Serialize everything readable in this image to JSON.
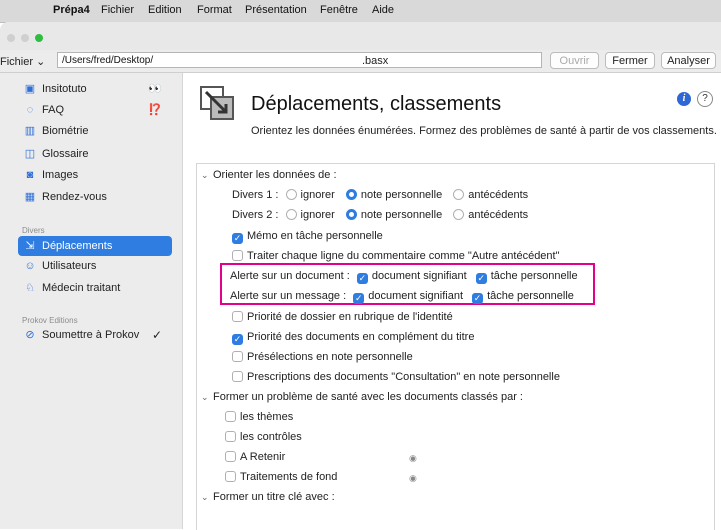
{
  "menubar": {
    "app": "Prépa4",
    "items": [
      "Fichier",
      "Edition",
      "Format",
      "Présentation",
      "Fenêtre",
      "Aide"
    ]
  },
  "toolbar": {
    "field_label": "Fichier",
    "path": "/Users/fred/Desktop/",
    "extension": ".basx",
    "open_label": "Ouvrir",
    "close_label": "Fermer",
    "analyze_label": "Analyser"
  },
  "sidebar": {
    "items": [
      {
        "label": "Insitotuto",
        "icon": "play-square-icon",
        "badge": "👀"
      },
      {
        "label": "FAQ",
        "icon": "chat-bubble-icon",
        "badge": "⁉️"
      },
      {
        "label": "Biométrie",
        "icon": "bar-chart-icon"
      },
      {
        "label": "Glossaire",
        "icon": "book-icon"
      },
      {
        "label": "Images",
        "icon": "camera-icon"
      },
      {
        "label": "Rendez-vous",
        "icon": "calendar-icon"
      }
    ],
    "section_divers": "Divers",
    "divers_items": [
      {
        "label": "Déplacements",
        "icon": "move-icon"
      },
      {
        "label": "Utilisateurs",
        "icon": "user-circle-icon"
      },
      {
        "label": "Médecin traitant",
        "icon": "people-icon"
      }
    ],
    "section_prokov": "Prokov Editions",
    "prokov_items": [
      {
        "label": "Soumettre à Prokov",
        "icon": "check-circle-icon",
        "badge": "✓"
      }
    ]
  },
  "header": {
    "title": "Déplacements, classements",
    "subtitle": "Orientez les données énumérées. Formez des problèmes de santé à partir de vos classements."
  },
  "panel": {
    "section1": "Orienter les données de :",
    "divers1_label": "Divers 1 :",
    "divers2_label": "Divers 2 :",
    "opt_ignorer": "ignorer",
    "opt_note": "note personnelle",
    "opt_antecedents": "antécédents",
    "memo": "Mémo en tâche personnelle",
    "traiter": "Traiter chaque ligne du commentaire comme \"Autre antécédent\"",
    "alerte_doc": "Alerte sur un document :",
    "alerte_msg": "Alerte sur un message :",
    "doc_signifiant": "document signifiant",
    "tache_perso": "tâche personnelle",
    "priorite_dossier": "Priorité de dossier en rubrique de l'identité",
    "priorite_docs": "Priorité des documents en complément du titre",
    "preselections": "Présélections en note personnelle",
    "prescriptions": "Prescriptions des documents \"Consultation\" en note personnelle",
    "section2": "Former un problème de santé avec les documents classés par :",
    "themes": "les thèmes",
    "controles": "les contrôles",
    "a_retenir": "A Retenir",
    "traitements": "Traitements de fond",
    "section3": "Former un titre clé avec :"
  },
  "colors": {
    "accent": "#2f7de1",
    "highlight": "#e3008c"
  }
}
